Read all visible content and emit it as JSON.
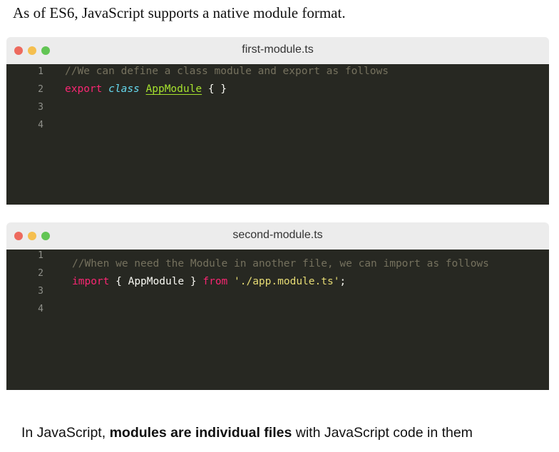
{
  "intro_text": "As of ES6, JavaScript supports a native module format.",
  "colors": {
    "close": "#ed6a5e",
    "minimize": "#f5bf4f",
    "maximize": "#62c554",
    "editor_bg": "#272822"
  },
  "windows": [
    {
      "title": "first-module.ts",
      "line_numbers": [
        "1",
        "2",
        "3",
        "4"
      ],
      "code": {
        "line1_comment": "//We can define a class module and export as follows",
        "line2_export": "export",
        "line2_class": "class",
        "line2_name": "AppModule",
        "line2_rest": "{ }"
      }
    },
    {
      "title": "second-module.ts",
      "line_numbers": [
        "1",
        "2",
        "3",
        "4"
      ],
      "code": {
        "line1_comment": "//When we need the Module in another file, we can import as follows",
        "line2_import": "import",
        "line2_braces": "{ AppModule }",
        "line2_from": "from",
        "line2_path": "'./app.module.ts'",
        "line2_semicolon": ";"
      }
    }
  ],
  "caption": {
    "before": "In JavaScript, ",
    "bold": "modules are individual files",
    "after": " with JavaScript code in them"
  }
}
